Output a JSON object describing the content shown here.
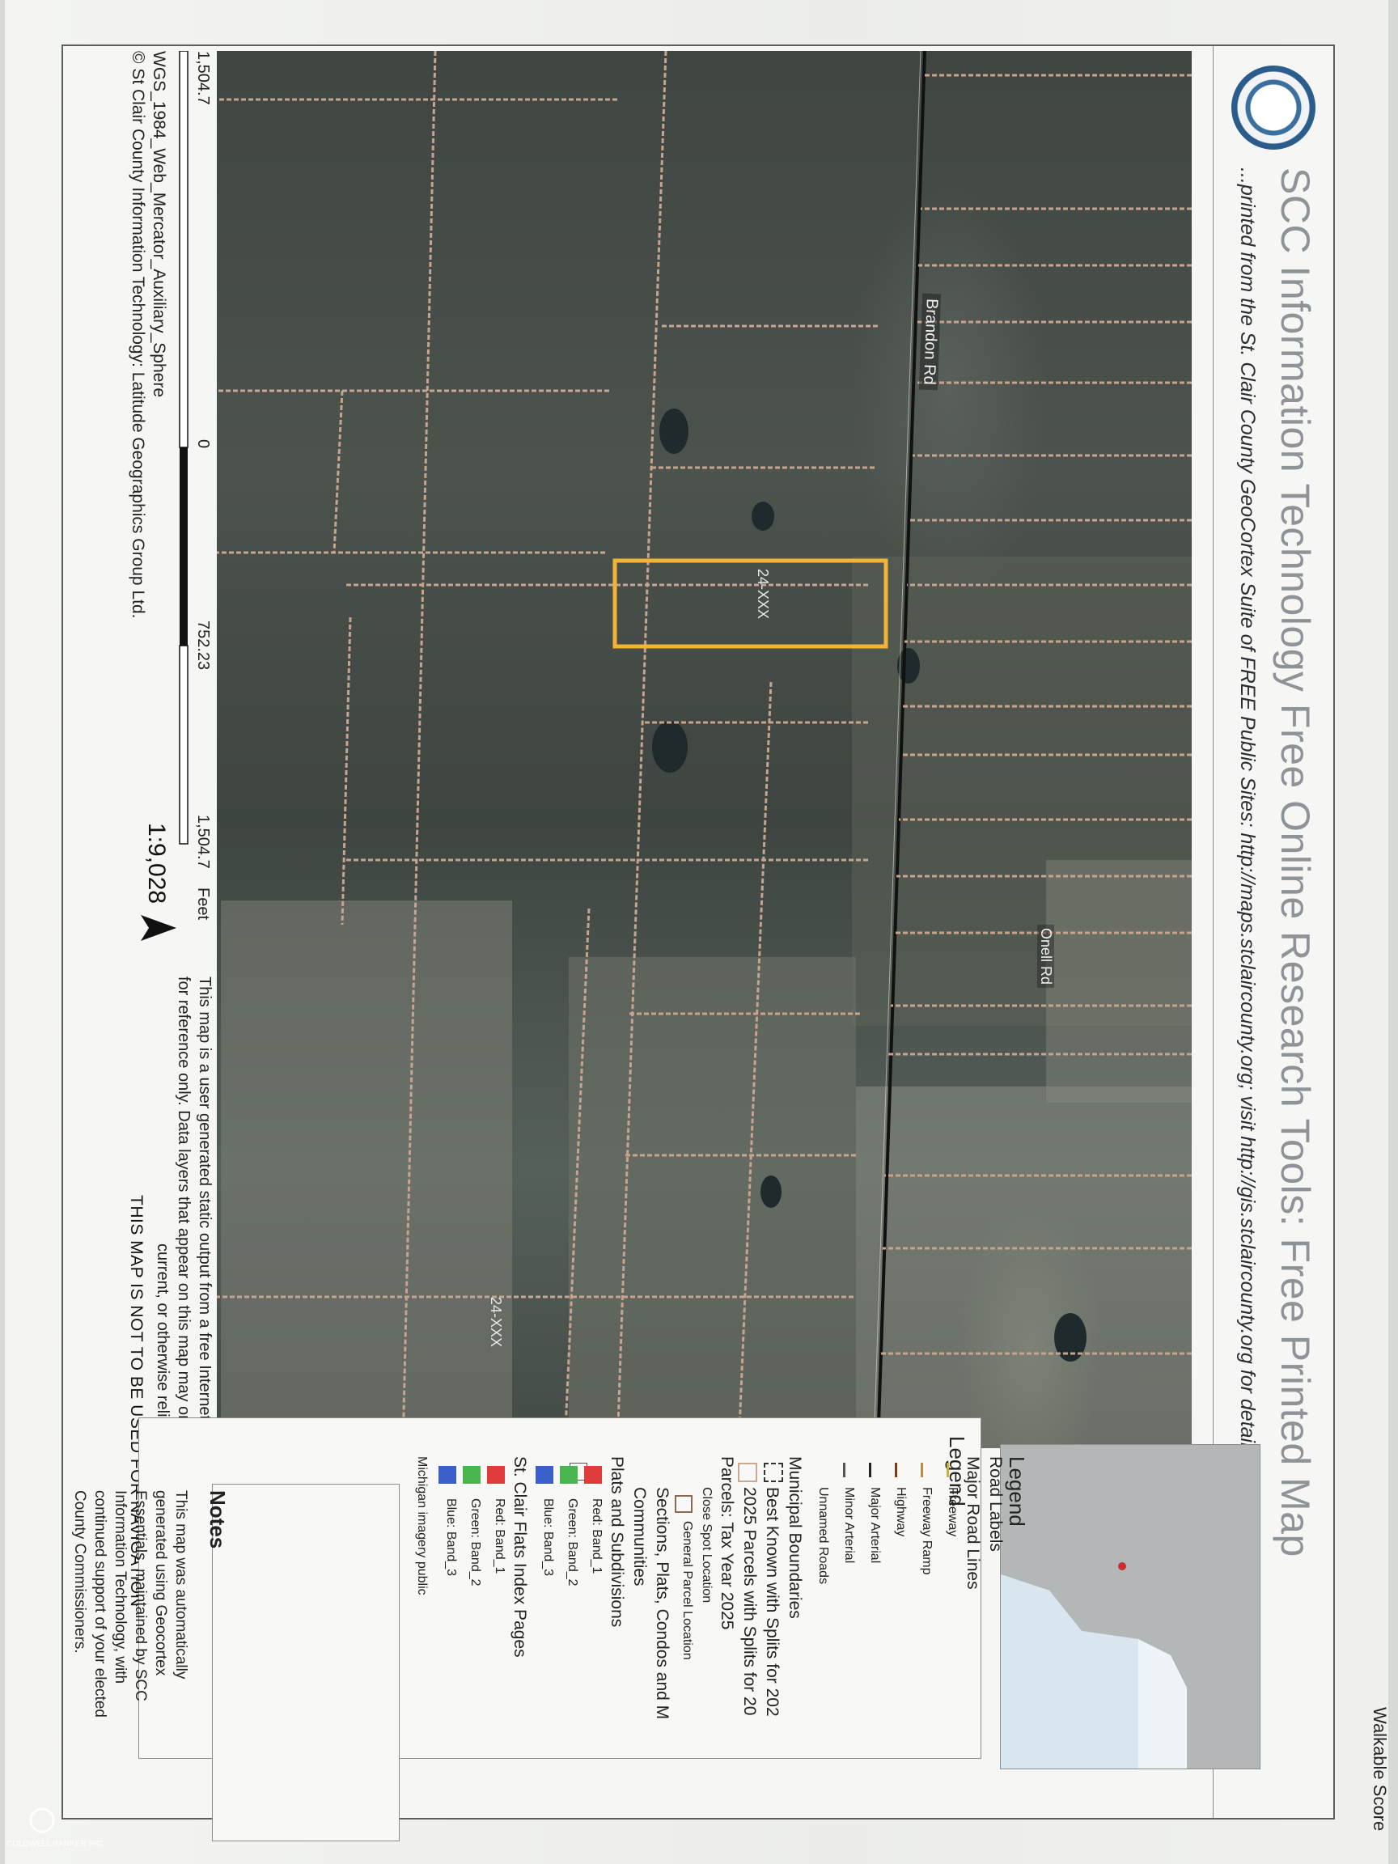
{
  "header": {
    "title": "SCC Information Technology Free Online Research Tools: Free Printed Map",
    "subtitle": "...printed from the St. Clair County GeoCortex Suite of FREE Public Sites: http://maps.stclaircounty.org; visit http://gis.stclaircounty.org for details."
  },
  "corner": {
    "top_right": "Walkable Score"
  },
  "map": {
    "road_labels": [
      "Brandon Rd",
      "Onell Rd"
    ],
    "parcel_labels": [
      "24-XXX",
      "24-XXX"
    ],
    "highlight_color": "#f2b437",
    "parcel_line_color": "#c8a48e"
  },
  "scale": {
    "ticks": [
      "1,504.7",
      "0",
      "752.23",
      "1,504.7"
    ],
    "unit": "Feet",
    "ratio": "1:9,028",
    "projection": "WGS_1984_Web_Mercator_Auxiliary_Sphere",
    "credit": "© St Clair County Information Technology: Latitude Geographics Group Ltd."
  },
  "disclaimer": {
    "line1": "This map is a user generated static output from a free Internet mapping site and is",
    "line2": "for reference only. Data layers that appear on this map may or may not be accurate,",
    "line3": "current, or otherwise reliable.",
    "nav_warning": "THIS MAP IS NOT TO BE USED FOR NAVIGATION"
  },
  "legend": {
    "title": "Legend",
    "items": [
      "Road Labels",
      "Major Road Lines",
      "Freeway",
      "Freeway Ramp",
      "Highway",
      "Major Arterial",
      "Minor Arterial",
      "Unnamed Roads",
      "Municipal Boundaries",
      "Best Known with Splits for 202",
      "2025 Parcels with Splits for 20",
      "Parcels: Tax Year 2025",
      "Close Spot Location",
      "General Parcel Location",
      "Sections, Plats, Condos and M",
      "Communities",
      "Plats and Subdivisions",
      "Red: Band_1",
      "Green: Band_2",
      "Blue: Band_3",
      "St. Clair Flats Index Pages",
      "Red: Band_1",
      "Green: Band_2",
      "Blue: Band_3",
      "Michigan imagery public"
    ],
    "colors": {
      "freeway": "#c9b23a",
      "ramp": "#b88d52",
      "highway": "#7a3b1e",
      "major": "#222222",
      "minor": "#555555",
      "red": "#e03c3c",
      "green": "#49b54e",
      "blue": "#3b5fc9"
    }
  },
  "notes": {
    "title": "Notes",
    "text": "This map was automatically generated using Geocortex Essentials, maintained by SCC Information Technology, with continued support of your elected County Commissioners."
  },
  "branding": {
    "logo": "COLDWELL BANKER PROFESSIONALS"
  }
}
